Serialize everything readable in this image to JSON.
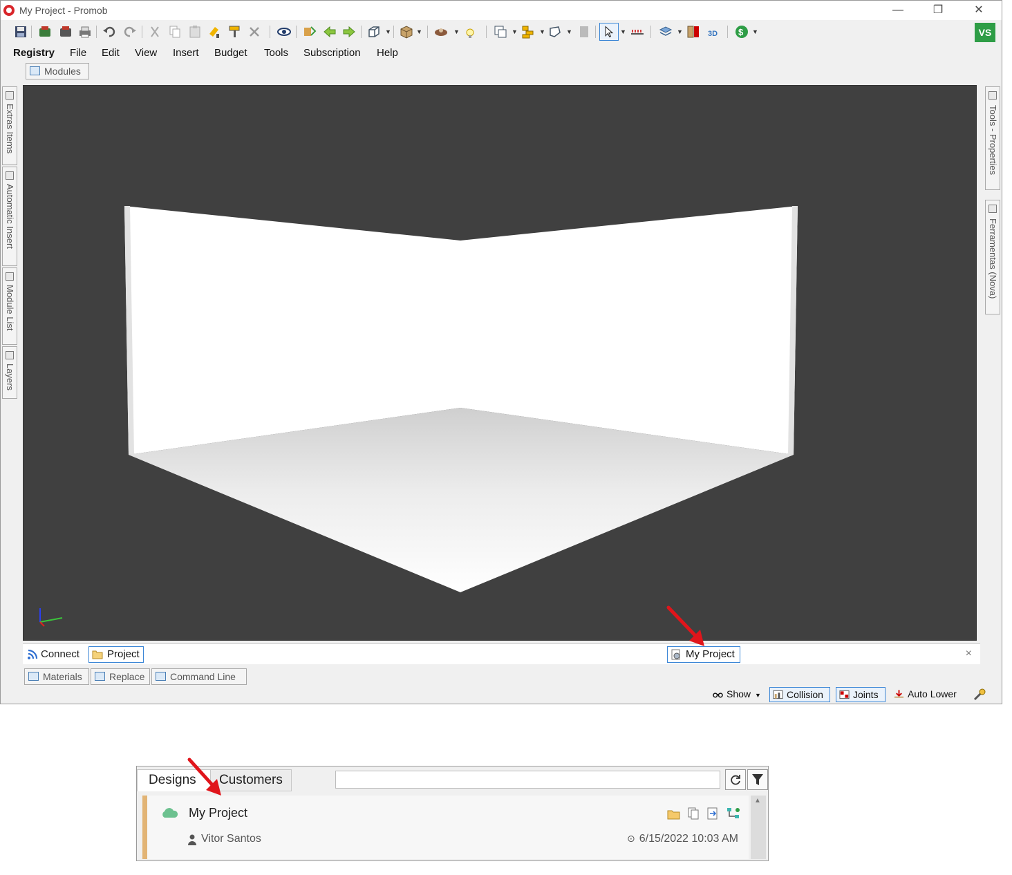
{
  "window": {
    "title": "My Project - Promob",
    "user_initials": "VS",
    "controls": [
      "—",
      "❐",
      "✕"
    ]
  },
  "menu": [
    "Registry",
    "File",
    "Edit",
    "View",
    "Insert",
    "Budget",
    "Tools",
    "Subscription",
    "Help"
  ],
  "top_tab": {
    "label": "Modules"
  },
  "side_tabs_left": [
    "Extras Items",
    "Automatic Insert",
    "Module List",
    "Layers"
  ],
  "side_tabs_right": [
    "Tools - Properties",
    "Ferramentas (Nova)"
  ],
  "doc_tabs": {
    "connect": "Connect",
    "project": "Project",
    "document": "My Project",
    "close": "×"
  },
  "bottom_tabs": [
    "Materials",
    "Replace",
    "Command Line"
  ],
  "status": {
    "show": "Show",
    "collision": "Collision",
    "joints": "Joints",
    "auto_lower": "Auto Lower"
  },
  "panel": {
    "tabs": [
      "Designs",
      "Customers"
    ],
    "search_value": "",
    "item": {
      "name": "My Project",
      "owner": "Vitor Santos",
      "date": "6/15/2022 10:03 AM"
    }
  },
  "colors": {
    "accent_blue": "#3b86d6",
    "viewport_bg": "#404040",
    "user_badge": "#2e9d46",
    "annotation_arrow": "#e0151b",
    "row_marker": "#e2b475"
  }
}
